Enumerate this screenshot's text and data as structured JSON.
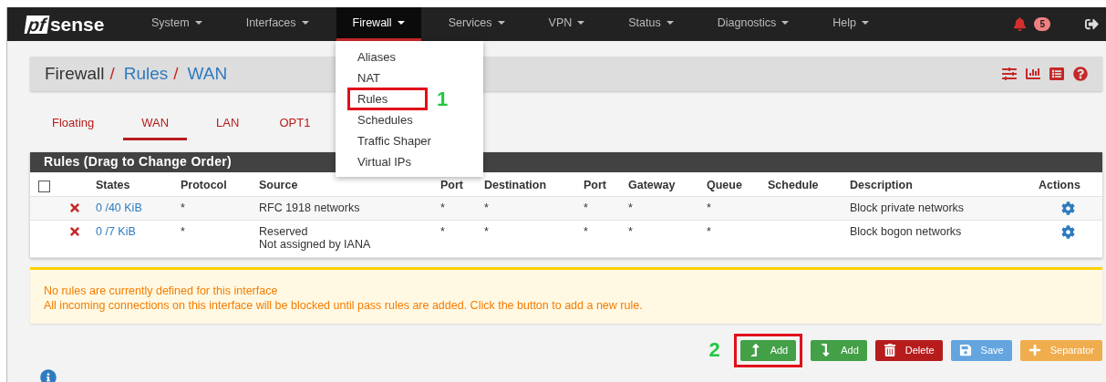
{
  "navbar": {
    "logo": {
      "mark": "pf",
      "word": "sense"
    },
    "menus": [
      {
        "label": "System",
        "selected": false
      },
      {
        "label": "Interfaces",
        "selected": false
      },
      {
        "label": "Firewall",
        "selected": true
      },
      {
        "label": "Services",
        "selected": false
      },
      {
        "label": "VPN",
        "selected": false
      },
      {
        "label": "Status",
        "selected": false
      },
      {
        "label": "Diagnostics",
        "selected": false
      },
      {
        "label": "Help",
        "selected": false
      }
    ],
    "notifications": {
      "count": "5"
    }
  },
  "firewall_menu": {
    "step": "1",
    "items": [
      {
        "label": "Aliases",
        "marked": false
      },
      {
        "label": "NAT",
        "marked": false
      },
      {
        "label": "Rules",
        "marked": true
      },
      {
        "label": "Schedules",
        "marked": false
      },
      {
        "label": "Traffic Shaper",
        "marked": false
      },
      {
        "label": "Virtual IPs",
        "marked": false
      }
    ]
  },
  "breadcrumb": {
    "separator": "/",
    "items": [
      {
        "label": "Firewall",
        "link": false
      },
      {
        "label": "Rules",
        "link": true
      },
      {
        "label": "WAN",
        "link": true
      }
    ]
  },
  "tabs": [
    {
      "label": "Floating",
      "selected": false
    },
    {
      "label": "WAN",
      "selected": true
    },
    {
      "label": "LAN",
      "selected": false
    },
    {
      "label": "OPT1",
      "selected": false
    }
  ],
  "table": {
    "title": "Rules (Drag to Change Order)",
    "select_all": {
      "checked": false
    },
    "columns": [
      "States",
      "Protocol",
      "Source",
      "Port",
      "Destination",
      "Port",
      "Gateway",
      "Queue",
      "Schedule",
      "Description",
      "Actions"
    ],
    "rows": [
      {
        "states": "0 /40 KiB",
        "protocol": "*",
        "source": [
          "RFC 1918 networks"
        ],
        "port": "*",
        "destination": "*",
        "destination_port": "*",
        "gateway": "*",
        "queue": "*",
        "description": "Block private networks"
      },
      {
        "states": "0 /7 KiB",
        "protocol": "*",
        "source": [
          "Reserved",
          "Not assigned by IANA"
        ],
        "port": "*",
        "destination": "*",
        "destination_port": "*",
        "gateway": "*",
        "queue": "*",
        "description": "Block bogon networks"
      }
    ]
  },
  "warning": {
    "lines": [
      "No rules are currently defined for this interface",
      "All incoming connections on this interface will be blocked until pass rules are added. Click the button to add a new rule."
    ]
  },
  "actions": {
    "step": "2",
    "buttons": [
      {
        "label": "Add",
        "kind": "add-top",
        "marked": true
      },
      {
        "label": "Add",
        "kind": "add-bottom",
        "marked": false
      },
      {
        "label": "Delete",
        "kind": "delete",
        "marked": false
      },
      {
        "label": "Save",
        "kind": "save",
        "marked": false
      },
      {
        "label": "Separator",
        "kind": "separator",
        "marked": false
      }
    ]
  }
}
